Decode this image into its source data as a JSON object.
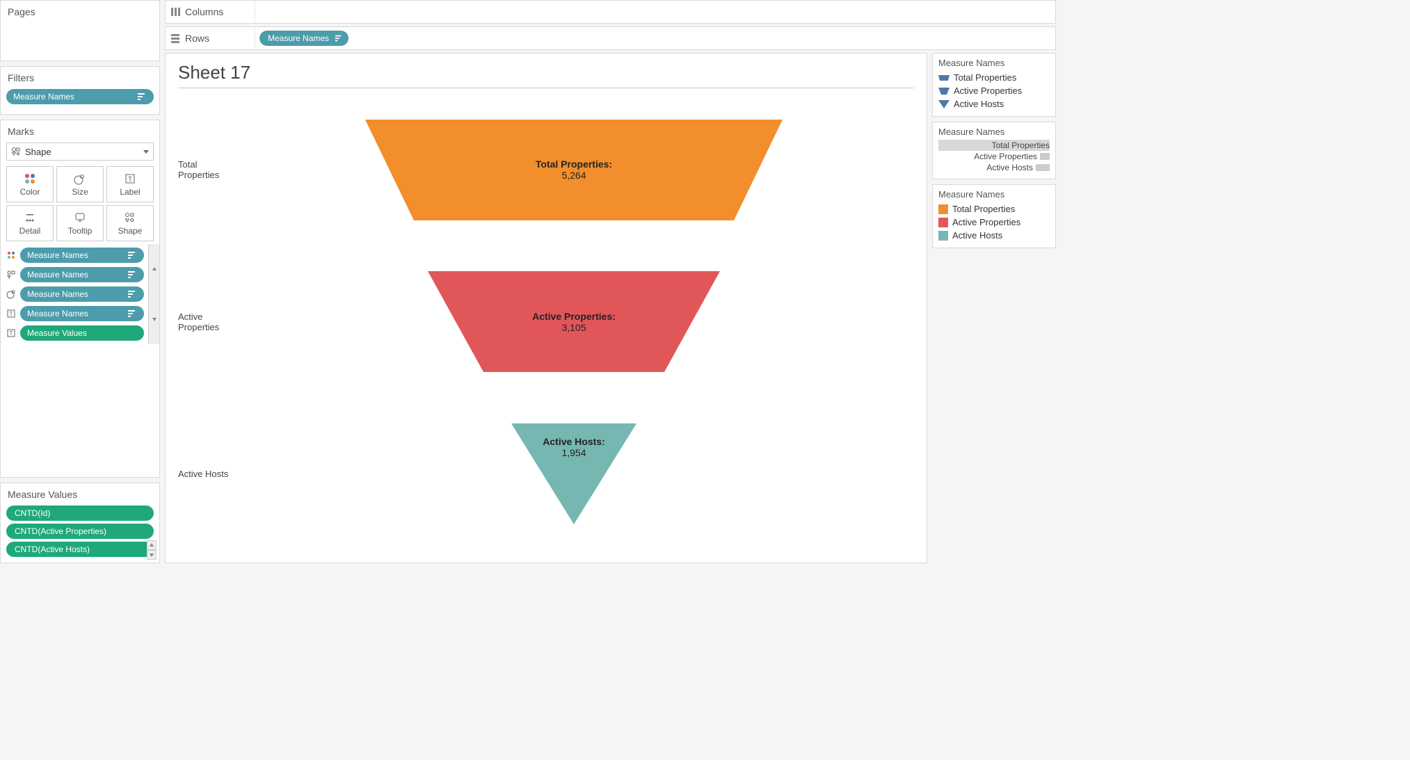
{
  "sidebar": {
    "pages_title": "Pages",
    "filters_title": "Filters",
    "filter_pill": "Measure Names",
    "marks_title": "Marks",
    "marks_type": "Shape",
    "marks_buttons": [
      "Color",
      "Size",
      "Label",
      "Detail",
      "Tooltip",
      "Shape"
    ],
    "mark_pills": [
      {
        "icon": "color",
        "label": "Measure Names",
        "color": "blue"
      },
      {
        "icon": "shape",
        "label": "Measure Names",
        "color": "blue"
      },
      {
        "icon": "size",
        "label": "Measure Names",
        "color": "blue"
      },
      {
        "icon": "text",
        "label": "Measure Names",
        "color": "blue"
      },
      {
        "icon": "text",
        "label": "Measure Values",
        "color": "green"
      }
    ],
    "mv_title": "Measure Values",
    "mv_pills": [
      "CNTD(Id)",
      "CNTD(Active Properties)",
      "CNTD(Active Hosts)"
    ]
  },
  "shelves": {
    "columns_label": "Columns",
    "rows_label": "Rows",
    "rows_pill": "Measure Names"
  },
  "viz": {
    "title": "Sheet 17",
    "rows": [
      {
        "label": "Total Properties",
        "dlabel": "Total Properties:",
        "value": "5,264",
        "color": "#f28e2b",
        "topW": 600,
        "botW": 460
      },
      {
        "label": "Active Properties",
        "dlabel": "Active Properties:",
        "value": "3,105",
        "color": "#e15759",
        "topW": 420,
        "botW": 260
      },
      {
        "label": "Active Hosts",
        "dlabel": "Active Hosts:",
        "value": "1,954",
        "color": "#76b7b2",
        "topW": 180,
        "botW": 0
      }
    ]
  },
  "legend_shape": {
    "title": "Measure Names",
    "items": [
      "Total Properties",
      "Active Properties",
      "Active Hosts"
    ]
  },
  "legend_size": {
    "title": "Measure Names",
    "items": [
      {
        "label": "Total Properties",
        "w": 30,
        "selected": true
      },
      {
        "label": "Active Properties",
        "w": 20,
        "selected": false
      },
      {
        "label": "Active Hosts",
        "w": 10,
        "selected": false
      }
    ]
  },
  "legend_color": {
    "title": "Measure Names",
    "items": [
      {
        "label": "Total Properties",
        "color": "#f28e2b"
      },
      {
        "label": "Active Properties",
        "color": "#e15759"
      },
      {
        "label": "Active Hosts",
        "color": "#76b7b2"
      }
    ]
  },
  "chart_data": {
    "type": "table",
    "title": "Sheet 17",
    "columns": [
      "Measure Name",
      "Value"
    ],
    "rows": [
      [
        "Total Properties",
        5264
      ],
      [
        "Active Properties",
        3105
      ],
      [
        "Active Hosts",
        1954
      ]
    ]
  }
}
